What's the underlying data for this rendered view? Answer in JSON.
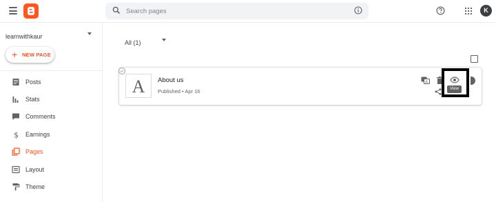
{
  "header": {
    "search_placeholder": "Search pages",
    "avatar_letter": "K"
  },
  "sidebar": {
    "blog_name": "learnwithkaur",
    "new_page_label": "NEW PAGE",
    "items": [
      {
        "label": "Posts",
        "icon": "posts-icon"
      },
      {
        "label": "Stats",
        "icon": "stats-icon"
      },
      {
        "label": "Comments",
        "icon": "comments-icon"
      },
      {
        "label": "Earnings",
        "icon": "dollar-icon"
      },
      {
        "label": "Pages",
        "icon": "pages-icon",
        "active": true
      },
      {
        "label": "Layout",
        "icon": "layout-icon"
      },
      {
        "label": "Theme",
        "icon": "paint-roller-icon"
      }
    ]
  },
  "main": {
    "filter_label": "All (1)",
    "page_item": {
      "thumbnail_letter": "A",
      "title": "About us",
      "meta": "Published • Apr 16"
    },
    "tooltip": "View"
  },
  "colors": {
    "accent": "#f4511e",
    "brand": "#ff5722"
  }
}
